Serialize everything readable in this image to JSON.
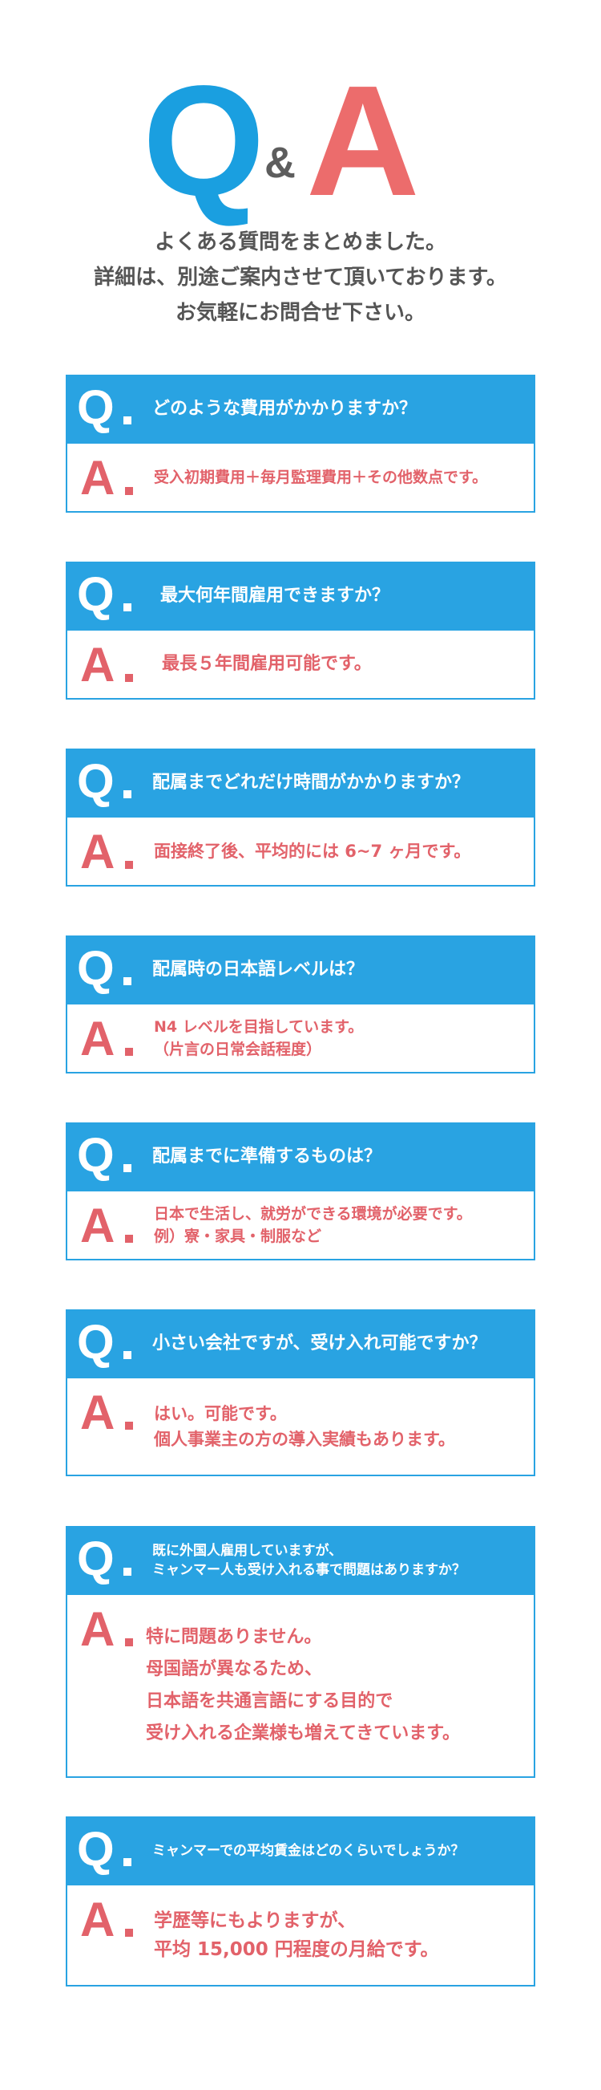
{
  "hero": {
    "q": "Q",
    "amp": "&",
    "a": "A"
  },
  "intro": {
    "lines": [
      "よくある質問をまとめました。",
      "詳細は、別途ご案内させて頂いております。",
      "お気軽にお問合せ下さい。"
    ]
  },
  "marks": {
    "q": "Q",
    "a": "A"
  },
  "colors": {
    "question_bg": "#29a3e2",
    "answer_text": "#e2626a",
    "hero_q": "#1a9fe0",
    "hero_a": "#ec6c6c"
  },
  "items": [
    {
      "question": [
        "どのような費用がかかりますか？"
      ],
      "answer": [
        "受入初期費用＋毎月監理費用＋その他数点です。"
      ]
    },
    {
      "question": [
        "最大何年間雇用できますか？"
      ],
      "answer": [
        "最長５年間雇用可能です。"
      ]
    },
    {
      "question": [
        "配属までどれだけ時間がかかりますか？"
      ],
      "answer": [
        "面接終了後、平均的には 6~7 ヶ月です。"
      ]
    },
    {
      "question": [
        "配属時の日本語レベルは？"
      ],
      "answer": [
        "N4 レベルを目指しています。",
        "（片言の日常会話程度）"
      ]
    },
    {
      "question": [
        "配属までに準備するものは？"
      ],
      "answer": [
        "日本で生活し、就労ができる環境が必要です。",
        "例）寮・家具・制服など"
      ]
    },
    {
      "question": [
        "小さい会社ですが、受け入れ可能ですか？"
      ],
      "answer": [
        "はい。可能です。",
        "個人事業主の方の導入実績もあります。"
      ]
    },
    {
      "question": [
        "既に外国人雇用していますが、",
        "ミャンマー人も受け入れる事で問題はありますか？"
      ],
      "answer": [
        "特に問題ありません。",
        "母国語が異なるため、",
        "日本語を共通言語にする目的で",
        "受け入れる企業様も増えてきています。"
      ]
    },
    {
      "question": [
        "ミャンマーでの平均賃金はどのくらいでしょうか？"
      ],
      "answer": [
        "学歴等にもよりますが、",
        "平均 15,000 円程度の月給です。"
      ]
    }
  ]
}
